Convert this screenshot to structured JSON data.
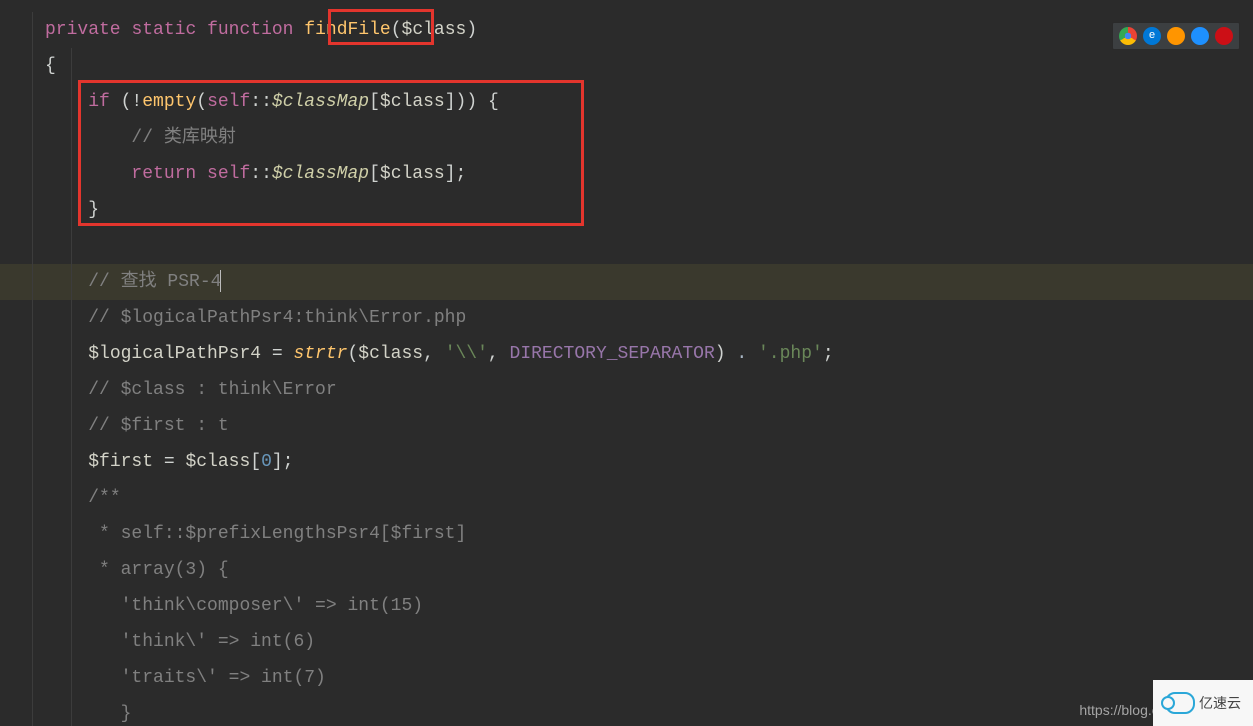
{
  "code": {
    "l1": {
      "kw1": "private",
      "kw2": "static",
      "kw3": "function",
      "fn": "findFile",
      "p1": "(",
      "var": "$class",
      "p2": ")"
    },
    "l2": {
      "brace": "{"
    },
    "l3": {
      "if": "if",
      "p1": " (!",
      "empty": "empty",
      "p2": "(",
      "self": "self",
      "scope": "::",
      "prop": "$classMap",
      "p3": "[",
      "var": "$class",
      "p4": "])) {"
    },
    "l4": {
      "comment": "// 类库映射"
    },
    "l5": {
      "return": "return",
      "self": "self",
      "scope": "::",
      "prop": "$classMap",
      "p1": "[",
      "var": "$class",
      "p2": "];"
    },
    "l6": {
      "brace": "}"
    },
    "l8": {
      "comment": "// 查找 PSR-4"
    },
    "l9": {
      "comment": "// $logicalPathPsr4:think\\Error.php"
    },
    "l10": {
      "var": "$logicalPathPsr4",
      "eq": " = ",
      "call": "strtr",
      "p1": "(",
      "arg": "$class",
      "c1": ", ",
      "s1": "'\\\\'",
      "c2": ", ",
      "const": "DIRECTORY_SEPARATOR",
      "p2": ") ",
      "dot": ".",
      "s2": " '.php'",
      "semi": ";"
    },
    "l11": {
      "comment": "// $class : think\\Error"
    },
    "l12": {
      "comment": "// $first : t"
    },
    "l13": {
      "var1": "$first",
      "eq": " = ",
      "var2": "$class",
      "p1": "[",
      "num": "0",
      "p2": "];"
    },
    "l14": {
      "comment": "/**"
    },
    "l15": {
      "comment": " * self::$prefixLengthsPsr4[$first]"
    },
    "l16": {
      "comment": " * array(3) {"
    },
    "l17": {
      "comment": "   'think\\composer\\' => int(15)"
    },
    "l18": {
      "comment": "   'think\\' => int(6)"
    },
    "l19": {
      "comment": "   'traits\\' => int(7)"
    },
    "l20": {
      "comment": "   }"
    }
  },
  "browsers": {
    "chrome": "",
    "edge": "e",
    "firefox": "",
    "safari": "",
    "opera": ""
  },
  "watermark": {
    "url": "https://blog.csdn.n",
    "logo": "亿速云"
  }
}
